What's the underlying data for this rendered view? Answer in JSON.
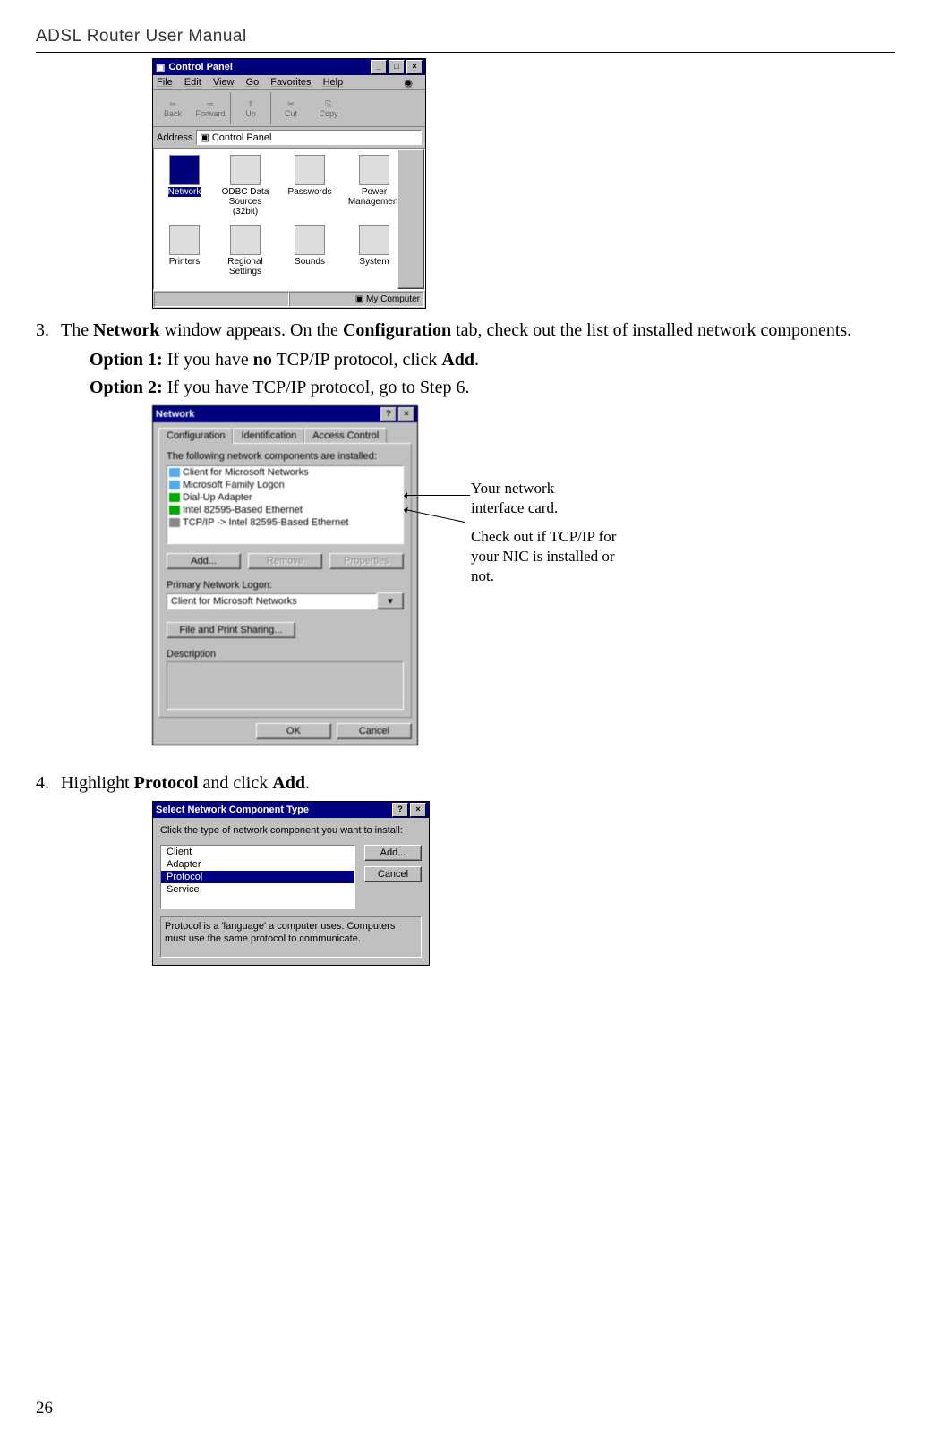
{
  "header": "ADSL Router User Manual",
  "page_number": "26",
  "steps": [
    {
      "num": "3.",
      "pre": "The ",
      "b1": "Network",
      "mid": " window appears. On the ",
      "b2": "Configuration",
      "post": " tab, check out the list of installed network components."
    },
    {
      "num": "4.",
      "pre": "Highlight ",
      "b1": "Protocol",
      "mid": " and click ",
      "b2": "Add",
      "post": "."
    }
  ],
  "options": {
    "o1_label": "Option 1:",
    "o1_text_a": " If you have ",
    "o1_b": "no",
    "o1_text_b": " TCP/IP protocol, click ",
    "o1_b2": "Add",
    "o1_text_c": ".",
    "o2_label": "Option 2:",
    "o2_text": " If you have TCP/IP protocol, go to Step 6."
  },
  "control_panel": {
    "title": "Control Panel",
    "sysicon": "▣",
    "menus": [
      "File",
      "Edit",
      "View",
      "Go",
      "Favorites",
      "Help"
    ],
    "tool_back": "Back",
    "tool_forward": "Forward",
    "tool_up": "Up",
    "tool_cut": "Cut",
    "tool_copy": "Copy",
    "address_label": "Address",
    "address_value": "Control Panel",
    "icons": [
      {
        "label": "Network",
        "sel": true
      },
      {
        "label": "ODBC Data Sources (32bit)"
      },
      {
        "label": "Passwords"
      },
      {
        "label": "Power Management"
      },
      {
        "label": "Printers"
      },
      {
        "label": "Regional Settings"
      },
      {
        "label": "Sounds"
      },
      {
        "label": "System"
      }
    ],
    "status": "My Computer"
  },
  "network": {
    "title": "Network",
    "tab1": "Configuration",
    "tab2": "Identification",
    "tab3": "Access Control",
    "list_prompt": "The following network components are installed:",
    "components": [
      "Client for Microsoft Networks",
      "Microsoft Family Logon",
      "Dial-Up Adapter",
      "Intel 82595-Based Ethernet",
      "TCP/IP -> Intel 82595-Based Ethernet"
    ],
    "add": "Add...",
    "remove": "Remove",
    "properties": "Properties",
    "primary_label": "Primary Network Logon:",
    "primary_value": "Client for Microsoft Networks",
    "file_share": "File and Print Sharing...",
    "desc_label": "Description",
    "ok": "OK",
    "cancel": "Cancel"
  },
  "callouts": {
    "c1": "Your network interface card.",
    "c2": "Check out if TCP/IP for your NIC is installed or not."
  },
  "select_comp": {
    "title": "Select Network Component Type",
    "prompt": "Click the type of network component you want to install:",
    "items": [
      "Client",
      "Adapter",
      "Protocol",
      "Service"
    ],
    "add": "Add...",
    "cancel": "Cancel",
    "desc": "Protocol is a 'language' a computer uses. Computers must use the same protocol to communicate."
  }
}
